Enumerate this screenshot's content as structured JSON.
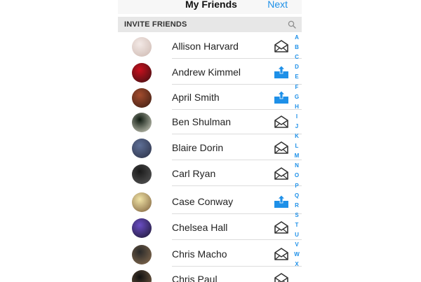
{
  "nav": {
    "title": "My Friends",
    "next_label": "Next"
  },
  "section": {
    "label": "INVITE FRIENDS",
    "search_icon": "search-icon"
  },
  "contacts": [
    {
      "name": "Allison Harvard",
      "action": "invite-envelope-icon",
      "colors": [
        "#f3e9e6",
        "#cdb8b0"
      ]
    },
    {
      "name": "Andrew Kimmel",
      "action": "share-upload-icon",
      "colors": [
        "#c9101e",
        "#391012"
      ]
    },
    {
      "name": "April Smith",
      "action": "share-upload-icon",
      "colors": [
        "#a34c2e",
        "#3a1c12"
      ]
    },
    {
      "name": "Ben Shulman",
      "action": "invite-envelope-icon",
      "colors": [
        "#0e1a10",
        "#d8d8c8"
      ]
    },
    {
      "name": "Blaire Dorin",
      "action": "invite-envelope-icon",
      "colors": [
        "#5e6f96",
        "#2a2f44"
      ]
    },
    {
      "name": "Carl Ryan",
      "action": "invite-envelope-icon",
      "colors": [
        "#1a1a1a",
        "#5a5a5a"
      ]
    },
    {
      "name": "Case Conway",
      "action": "share-upload-icon",
      "colors": [
        "#f1e4a6",
        "#7b5d3a"
      ]
    },
    {
      "name": "Chelsea Hall",
      "action": "invite-envelope-icon",
      "colors": [
        "#6a4dc4",
        "#1a152c"
      ]
    },
    {
      "name": "Chris Macho",
      "action": "invite-envelope-icon",
      "colors": [
        "#2a2a2a",
        "#8a6e50"
      ]
    },
    {
      "name": "Chris Paul",
      "action": "invite-envelope-icon",
      "colors": [
        "#111111",
        "#7a6248"
      ]
    }
  ],
  "index_letters": [
    "A",
    "B",
    "C",
    "D",
    "E",
    "F",
    "G",
    "H",
    "I",
    "J",
    "K",
    "L",
    "M",
    "N",
    "O",
    "P",
    "Q",
    "R",
    "S",
    "T",
    "U",
    "V",
    "W",
    "X"
  ],
  "colors": {
    "accent": "#1e90e8",
    "section_bg": "#e7e7e7",
    "envelope": "#333333"
  }
}
